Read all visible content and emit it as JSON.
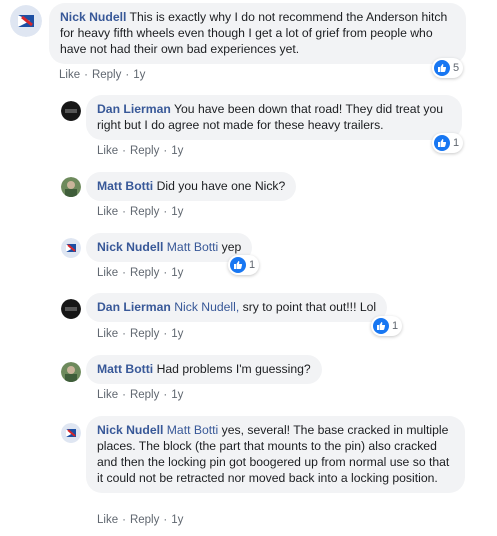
{
  "actions": {
    "like": "Like",
    "reply": "Reply",
    "separator": "·"
  },
  "comments": [
    {
      "author": "Nick Nudell",
      "mention": "",
      "text": "This is exactly why I do not recommend the Anderson hitch for heavy fifth wheels even though I get a lot of grief from people who have not had their own bad experiences yet.",
      "time": "1y",
      "reactions": "5",
      "avatar": "nick-avatar"
    },
    {
      "author": "Dan Lierman",
      "mention": "",
      "text": "You have been down that road! They did treat you right but I do agree not made for these heavy trailers.",
      "time": "1y",
      "reactions": "1",
      "avatar": "dan-avatar"
    },
    {
      "author": "Matt Botti",
      "mention": "",
      "text": "Did you have one Nick?",
      "time": "1y",
      "reactions": "",
      "avatar": "matt-avatar"
    },
    {
      "author": "Nick Nudell",
      "mention": "Matt Botti",
      "text": "yep",
      "time": "1y",
      "reactions": "1",
      "avatar": "nick-avatar"
    },
    {
      "author": "Dan Lierman",
      "mention": "Nick Nudell,",
      "text": "sry to point that out!!! Lol",
      "time": "1y",
      "reactions": "1",
      "avatar": "dan-avatar"
    },
    {
      "author": "Matt Botti",
      "mention": "",
      "text": "Had problems I'm guessing?",
      "time": "1y",
      "reactions": "",
      "avatar": "matt-avatar"
    },
    {
      "author": "Nick Nudell",
      "mention": "Matt Botti",
      "text": "yes, several! The base cracked in multiple places. The block (the part that mounts to the pin) also cracked and then the locking pin got boogered up from normal use so that it could not be retracted nor moved back into a locking position.",
      "time": "1y",
      "reactions": "",
      "avatar": "nick-avatar"
    }
  ],
  "colors": {
    "name": "#385898",
    "bubble": "#f2f3f5",
    "meta": "#606770",
    "like": "#1877f2"
  }
}
